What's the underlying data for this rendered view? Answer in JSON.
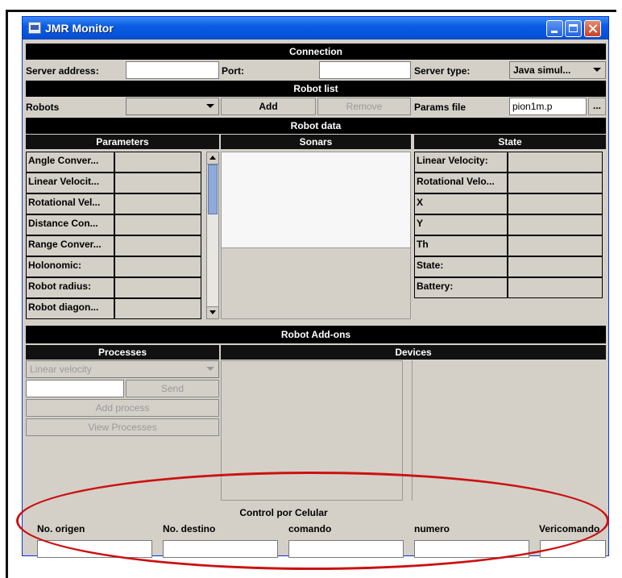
{
  "window": {
    "title": "JMR Monitor"
  },
  "connection": {
    "header": "Connection",
    "server_address_label": "Server address:",
    "server_address_value": "",
    "port_label": "Port:",
    "port_value": "",
    "server_type_label": "Server type:",
    "server_type_value": "Java simul..."
  },
  "robot_list": {
    "header": "Robot list",
    "robots_label": "Robots",
    "robots_value": "",
    "add_label": "Add",
    "remove_label": "Remove",
    "params_file_label": "Params file",
    "params_file_value": "pion1m.p",
    "browse_label": "..."
  },
  "robot_data": {
    "header": "Robot data",
    "parameters_header": "Parameters",
    "sonars_header": "Sonars",
    "state_header": "State",
    "parameters": [
      {
        "label": "Angle Conver...",
        "value": ""
      },
      {
        "label": "Linear Velocit...",
        "value": ""
      },
      {
        "label": "Rotational Vel...",
        "value": ""
      },
      {
        "label": "Distance Con...",
        "value": ""
      },
      {
        "label": "Range Conver...",
        "value": ""
      },
      {
        "label": "Holonomic:",
        "value": ""
      },
      {
        "label": "Robot radius:",
        "value": ""
      },
      {
        "label": "Robot diagon...",
        "value": ""
      }
    ],
    "state": [
      {
        "label": "Linear Velocity:",
        "value": ""
      },
      {
        "label": "Rotational Velo...",
        "value": ""
      },
      {
        "label": "X",
        "value": ""
      },
      {
        "label": "Y",
        "value": ""
      },
      {
        "label": "Th",
        "value": ""
      },
      {
        "label": "State:",
        "value": ""
      },
      {
        "label": "Battery:",
        "value": ""
      }
    ]
  },
  "addons": {
    "header": "Robot Add-ons",
    "processes_header": "Processes",
    "devices_header": "Devices",
    "process_select_value": "Linear velocity",
    "process_input_value": "",
    "send_label": "Send",
    "add_process_label": "Add process",
    "view_processes_label": "View Processes"
  },
  "control": {
    "title": "Control por Celular",
    "fields": [
      {
        "label": "No. origen",
        "value": ""
      },
      {
        "label": "No. destino",
        "value": ""
      },
      {
        "label": "comando",
        "value": ""
      },
      {
        "label": "numero",
        "value": ""
      },
      {
        "label": "Vericomando",
        "value": ""
      }
    ]
  },
  "colors": {
    "titlebar": "#0a5de3",
    "header_bar": "#000000",
    "panel": "#d4d0c8",
    "highlight_oval": "#cc1111"
  }
}
